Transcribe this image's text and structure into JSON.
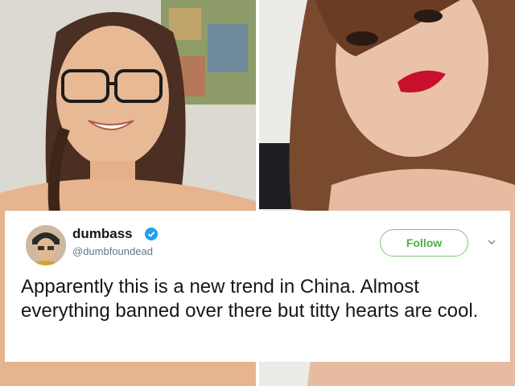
{
  "photos": {
    "left": {
      "name": "left-selfie-photo"
    },
    "right": {
      "name": "right-selfie-photo"
    }
  },
  "tweet": {
    "display_name": "dumbass",
    "handle": "@dumbfoundead",
    "follow_label": "Follow",
    "text": "Apparently this is a new trend in China. Almost everything banned over there but titty hearts are cool.",
    "verified": true
  },
  "colors": {
    "follow_accent": "#4fae48",
    "verified_badge": "#1da1f2",
    "lip_red": "#c8102e"
  },
  "icons": {
    "verified": "verified-badge-icon",
    "more": "chevron-down-icon"
  }
}
